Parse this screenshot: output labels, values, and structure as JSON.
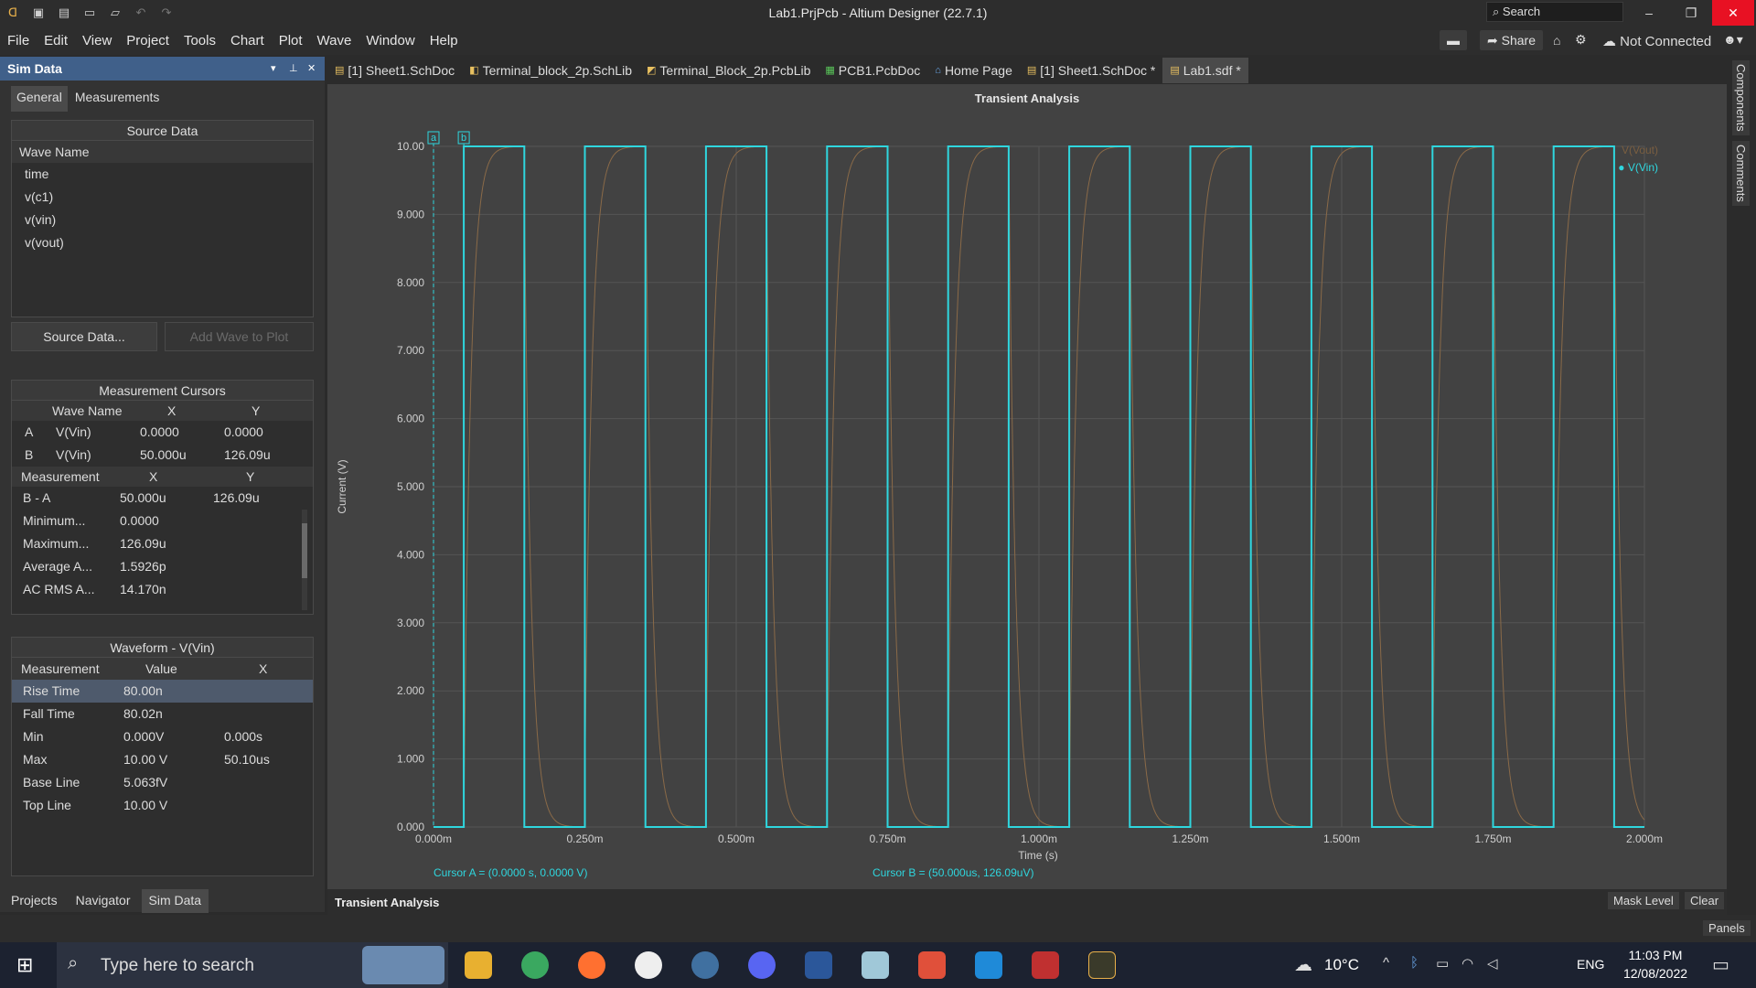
{
  "window": {
    "title": "Lab1.PrjPcb - Altium Designer (22.7.1)",
    "search_label": "Search"
  },
  "menu": [
    "File",
    "Edit",
    "View",
    "Project",
    "Tools",
    "Chart",
    "Plot",
    "Wave",
    "Window",
    "Help"
  ],
  "toolbar_right": {
    "share": "Share",
    "connection": "Not Connected"
  },
  "panel": {
    "title": "Sim Data",
    "tabs": [
      "General",
      "Measurements"
    ],
    "source_data": {
      "header": "Source Data",
      "col": "Wave Name",
      "items": [
        "time",
        "v(c1)",
        "v(vin)",
        "v(vout)"
      ],
      "source_button": "Source Data...",
      "add_button": "Add Wave to Plot"
    },
    "cursors": {
      "header": "Measurement Cursors",
      "cols": [
        "Wave Name",
        "X",
        "Y"
      ],
      "rows": [
        {
          "id": "A",
          "wave": "V(Vin)",
          "x": "0.0000",
          "y": "0.0000"
        },
        {
          "id": "B",
          "wave": "V(Vin)",
          "x": "50.000u",
          "y": "126.09u"
        }
      ],
      "mcols": [
        "Measurement",
        "X",
        "Y"
      ],
      "mrows": [
        {
          "name": "B - A",
          "x": "50.000u",
          "y": "126.09u"
        },
        {
          "name": "Minimum...",
          "x": "0.0000",
          "y": ""
        },
        {
          "name": "Maximum...",
          "x": "126.09u",
          "y": ""
        },
        {
          "name": "Average  A...",
          "x": "1.5926p",
          "y": ""
        },
        {
          "name": "AC RMS  A...",
          "x": "14.170n",
          "y": ""
        }
      ]
    },
    "waveform": {
      "header": "Waveform - V(Vin)",
      "cols": [
        "Measurement",
        "Value",
        "X"
      ],
      "rows": [
        {
          "name": "Rise Time",
          "value": "80.00n",
          "x": ""
        },
        {
          "name": "Fall Time",
          "value": "80.02n",
          "x": ""
        },
        {
          "name": "Min",
          "value": "0.000V",
          "x": "0.000s"
        },
        {
          "name": "Max",
          "value": "10.00 V",
          "x": "50.10us"
        },
        {
          "name": "Base Line",
          "value": "5.063fV",
          "x": ""
        },
        {
          "name": "Top Line",
          "value": "10.00 V",
          "x": ""
        }
      ]
    },
    "bottom_tabs": [
      "Projects",
      "Navigator",
      "Sim Data"
    ]
  },
  "doc_tabs": [
    "[1] Sheet1.SchDoc",
    "Terminal_block_2p.SchLib",
    "Terminal_Block_2p.PcbLib",
    "PCB1.PcbDoc",
    "Home Page",
    "[1] Sheet1.SchDoc *",
    "Lab1.sdf *"
  ],
  "right_panels": [
    "Components",
    "Comments"
  ],
  "chart_data": {
    "type": "line",
    "title": "Transient Analysis",
    "xlabel": "Time (s)",
    "ylabel": "Current (V)",
    "xlim": [
      0,
      0.002
    ],
    "ylim": [
      0,
      10
    ],
    "x_ticks": [
      "0.000m",
      "0.250m",
      "0.500m",
      "0.750m",
      "1.000m",
      "1.250m",
      "1.500m",
      "1.750m",
      "2.000m"
    ],
    "y_ticks": [
      "0.000",
      "1.000",
      "2.000",
      "3.000",
      "4.000",
      "5.000",
      "6.000",
      "7.000",
      "8.000",
      "9.000",
      "10.00"
    ],
    "series": [
      {
        "name": "V(Vout)",
        "color": "#8a6a48",
        "kind": "rc_response",
        "period_s": 0.0002,
        "high_s": 0.0001,
        "amplitude": 10
      },
      {
        "name": "V(Vin)",
        "color": "#2fd6de",
        "kind": "square",
        "period_s": 0.0002,
        "high_s": 0.0001,
        "amplitude": 10
      }
    ],
    "cursors": [
      {
        "label": "a",
        "x": 0
      },
      {
        "label": "b",
        "x": 5e-05
      }
    ],
    "cursor_a_text": "Cursor A = (0.0000 s, 0.0000 V)",
    "cursor_b_text": "Cursor B = (50.000us, 126.09uV)",
    "footer_tab": "Transient Analysis",
    "mask_level": "Mask Level",
    "clear": "Clear",
    "grid": true
  },
  "status": {
    "panels": "Panels"
  },
  "taskbar": {
    "search_placeholder": "Type here to search",
    "temp": "10°C",
    "lang": "ENG",
    "time": "11:03 PM",
    "date": "12/08/2022"
  }
}
